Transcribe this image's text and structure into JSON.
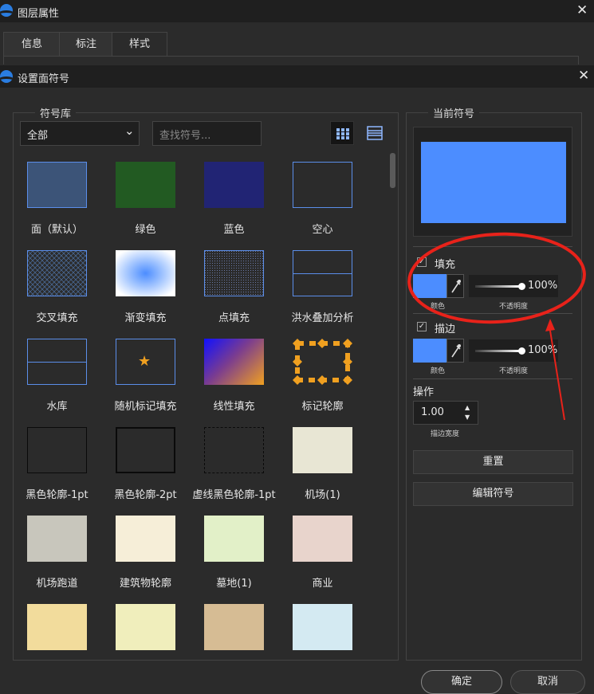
{
  "window": {
    "title": "图层属性",
    "close": "✕"
  },
  "tabs": [
    "信息",
    "标注",
    "样式"
  ],
  "dialog": {
    "title": "设置面符号",
    "close": "✕"
  },
  "library": {
    "legend": "符号库",
    "filter_value": "全部",
    "filter_caret": "⌄",
    "search_placeholder": "查找符号...",
    "symbols": [
      {
        "label": "面（默认）",
        "style": "default"
      },
      {
        "label": "绿色",
        "style": "green"
      },
      {
        "label": "蓝色",
        "style": "blue"
      },
      {
        "label": "空心",
        "style": "hollow"
      },
      {
        "label": "交叉填充",
        "style": "cross"
      },
      {
        "label": "渐变填充",
        "style": "gradient"
      },
      {
        "label": "点填充",
        "style": "dots"
      },
      {
        "label": "洪水叠加分析",
        "style": "flood"
      },
      {
        "label": "水库",
        "style": "reservoir"
      },
      {
        "label": "随机标记填充",
        "style": "star"
      },
      {
        "label": "线性填充",
        "style": "linear"
      },
      {
        "label": "标记轮廓",
        "style": "marker"
      },
      {
        "label": "黑色轮廓-1pt",
        "style": "black1"
      },
      {
        "label": "黑色轮廓-2pt",
        "style": "black2"
      },
      {
        "label": "虚线黑色轮廓-1pt",
        "style": "dashed"
      },
      {
        "label": "机场(1)",
        "style": "airport"
      },
      {
        "label": "机场跑道",
        "style": "runway"
      },
      {
        "label": "建筑物轮廓",
        "style": "building"
      },
      {
        "label": "墓地(1)",
        "style": "cemetery"
      },
      {
        "label": "商业",
        "style": "commercial"
      },
      {
        "label": "",
        "style": "yellow"
      },
      {
        "label": "",
        "style": "lightyellow"
      },
      {
        "label": "",
        "style": "tan"
      },
      {
        "label": "",
        "style": "lightblue"
      }
    ],
    "star_glyph": "★"
  },
  "current": {
    "legend": "当前符号",
    "fill": {
      "label": "填充",
      "checked": "✓",
      "color_caption": "颜色",
      "opacity_caption": "不透明度",
      "opacity": "100%",
      "color": "#4c8dff"
    },
    "stroke": {
      "label": "描边",
      "checked": "✓",
      "color_caption": "颜色",
      "opacity_caption": "不透明度",
      "opacity": "100%",
      "color": "#4c8dff"
    },
    "ops": {
      "label": "操作",
      "width_value": "1.00",
      "width_caption": "描边宽度",
      "up": "▲",
      "down": "▼"
    },
    "reset_label": "重置",
    "edit_label": "编辑符号"
  },
  "footer": {
    "ok_label": "确定",
    "cancel_label": "取消"
  },
  "colors": {
    "accent": "#4c8dff",
    "annotation": "#e8221a"
  }
}
